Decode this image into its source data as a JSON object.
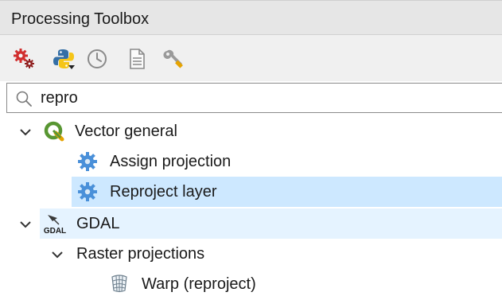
{
  "panel": {
    "title": "Processing Toolbox"
  },
  "toolbar": {
    "buttons": [
      {
        "icon": "models-gear-icon"
      },
      {
        "icon": "python-icon"
      },
      {
        "icon": "history-clock-icon"
      },
      {
        "icon": "results-document-icon"
      },
      {
        "icon": "options-wrench-icon"
      }
    ]
  },
  "search": {
    "value": "repro"
  },
  "tree": {
    "vector_general": {
      "label": "Vector general",
      "items": [
        {
          "label": "Assign projection"
        },
        {
          "label": "Reproject layer"
        }
      ]
    },
    "gdal": {
      "label": "GDAL",
      "icon_text": "GDAL",
      "raster_projections": {
        "label": "Raster projections",
        "items": [
          {
            "label": "Warp (reproject)"
          }
        ]
      }
    }
  },
  "colors": {
    "selection": "#cde8ff",
    "hover": "#e5f3ff",
    "qgis_green": "#589632",
    "gear_blue": "#4a90d9"
  }
}
